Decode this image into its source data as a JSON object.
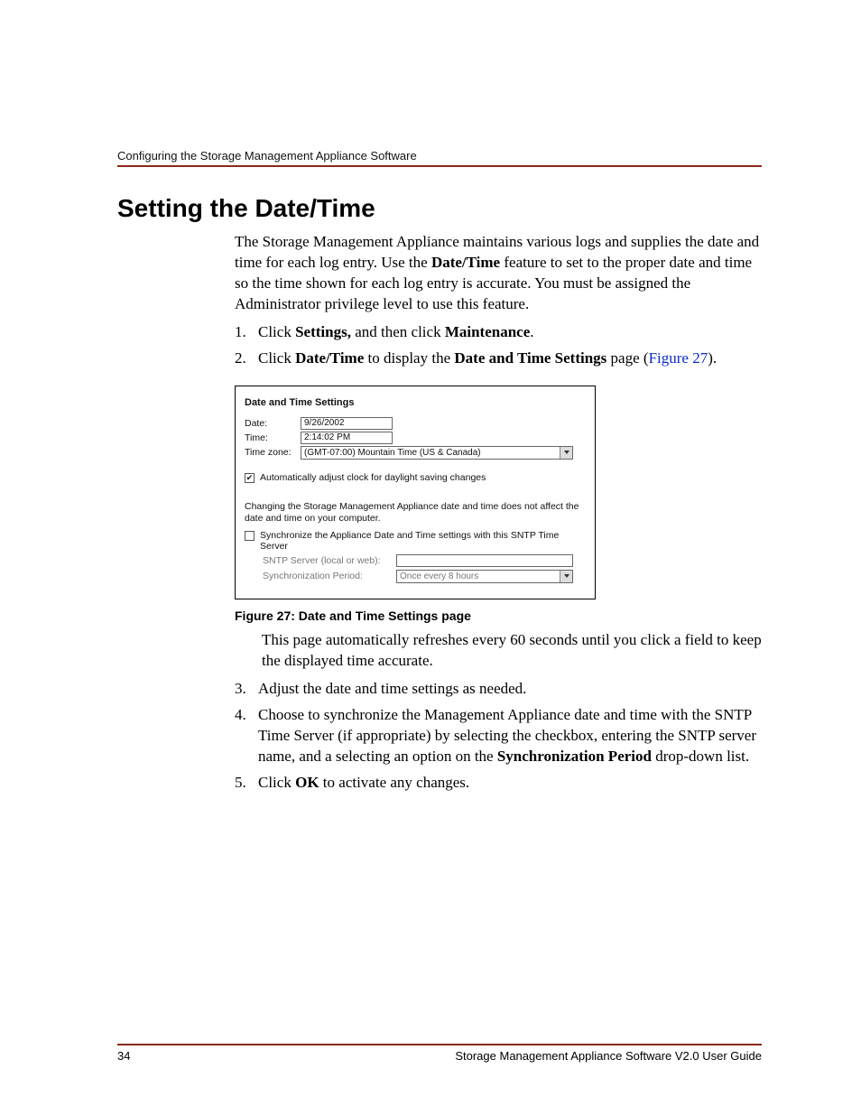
{
  "header": {
    "section": "Configuring the Storage Management Appliance Software"
  },
  "title": "Setting the Date/Time",
  "intro": {
    "p1a": "The Storage Management Appliance maintains various logs and supplies the date and time for each log entry. Use the ",
    "p1b": "Date/Time",
    "p1c": " feature to set to the proper date and time so the time shown for each log entry is accurate. You must be assigned the Administrator privilege level to use this feature."
  },
  "steps": {
    "s1_num": "1.",
    "s1a": "Click ",
    "s1b": "Settings,",
    "s1c": " and then click ",
    "s1d": "Maintenance",
    "s1e": ".",
    "s2_num": "2.",
    "s2a": "Click ",
    "s2b": "Date/Time",
    "s2c": " to display the ",
    "s2d": "Date and Time Settings",
    "s2e": " page (",
    "s2f": "Figure 27",
    "s2g": ").",
    "s3_num": "3.",
    "s3": "Adjust the date and time settings as needed.",
    "s4_num": "4.",
    "s4a": "Choose to synchronize the Management Appliance date and time with the SNTP Time Server (if appropriate) by selecting the checkbox, entering the SNTP server name, and a selecting an option on the ",
    "s4b": "Synchronization Period",
    "s4c": " drop-down list.",
    "s5_num": "5.",
    "s5a": "Click ",
    "s5b": "OK",
    "s5c": " to activate any changes."
  },
  "figure": {
    "panel_title": "Date and Time Settings",
    "date_label": "Date:",
    "date_value": "9/26/2002",
    "time_label": "Time:",
    "time_value": "2:14:02 PM",
    "tz_label": "Time zone:",
    "tz_value": "(GMT-07:00) Mountain Time (US & Canada)",
    "auto_dst_mark": "✔",
    "auto_dst": "Automatically adjust clock for daylight saving changes",
    "note": "Changing the Storage Management Appliance date and time does not affect the date and time on your computer.",
    "sync_chk": "Synchronize the Appliance Date and Time settings with this SNTP Time Server",
    "sntp_label": "SNTP Server (local or web):",
    "period_label": "Synchronization Period:",
    "period_value": "Once every 8 hours",
    "caption": "Figure 27:  Date and Time Settings page"
  },
  "post_figure": "This page automatically refreshes every 60 seconds until you click a field to keep the displayed time accurate.",
  "footer": {
    "page_num": "34",
    "doc_title": "Storage Management Appliance Software V2.0 User Guide"
  }
}
